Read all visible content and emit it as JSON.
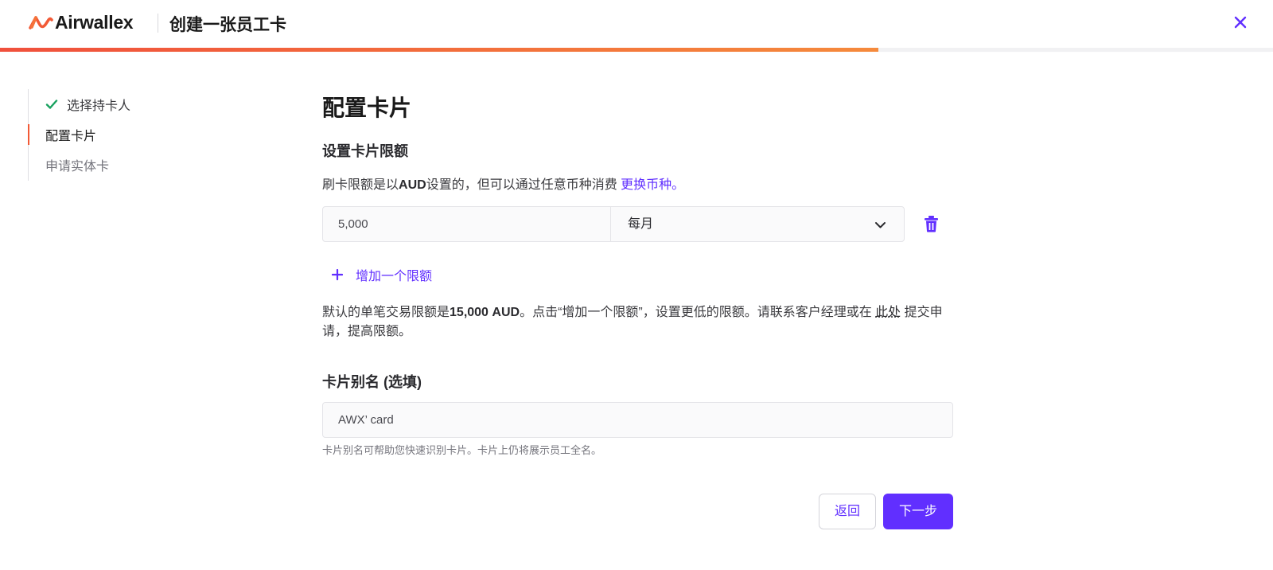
{
  "header": {
    "brand": "Airwallex",
    "title": "创建一张员工卡",
    "progress_fraction": 0.69
  },
  "colors": {
    "accent": "#612fff",
    "brand_orange": "#f25a36",
    "success_green": "#1aa260"
  },
  "stepper": {
    "steps": [
      {
        "label": "选择持卡人",
        "state": "completed"
      },
      {
        "label": "配置卡片",
        "state": "active"
      },
      {
        "label": "申请实体卡",
        "state": "upcoming"
      }
    ]
  },
  "main": {
    "title": "配置卡片",
    "limit_section": {
      "title": "设置卡片限额",
      "desc_prefix": "刷卡限额是以",
      "desc_currency": "AUD",
      "desc_suffix": "设置的，但可以通过任意币种消费 ",
      "change_currency_link": "更换币种。",
      "amount_value": "5,000",
      "period_value": "每月",
      "add_limit_label": "增加一个限额",
      "note_prefix": "默认的单笔交易限额是",
      "note_amount": "15,000 AUD",
      "note_middle": "。点击“增加一个限额”，设置更低的限额。请联系客户经理或在 ",
      "note_link": "此处",
      "note_suffix": " 提交申请，提高限额。"
    },
    "alias_section": {
      "title": "卡片别名 (选填)",
      "value": "AWX’ card",
      "helper": "卡片别名可帮助您快速识别卡片。卡片上仍将展示员工全名。"
    },
    "footer": {
      "back_label": "返回",
      "next_label": "下一步"
    }
  }
}
